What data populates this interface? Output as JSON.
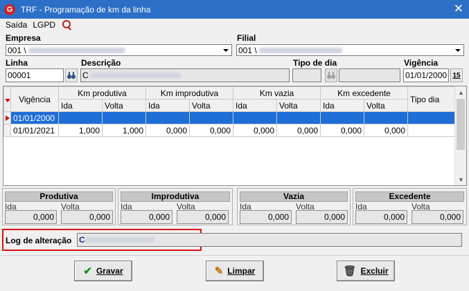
{
  "window": {
    "title": "TRF - Programação de km da linha",
    "close": "✕",
    "app_icon": "G"
  },
  "menu": {
    "items": [
      "Saída",
      "LGPD"
    ],
    "search_icon": "search-icon"
  },
  "empresa": {
    "label": "Empresa",
    "value": "001 \\"
  },
  "filial": {
    "label": "Filial",
    "value": "001 \\"
  },
  "linha": {
    "label": "Linha",
    "value": "00001"
  },
  "descricao": {
    "label": "Descrição",
    "value": "C"
  },
  "tipo_dia": {
    "label": "Tipo de dia",
    "value": ""
  },
  "vigencia": {
    "label": "Vigência",
    "value": "01/01/2000",
    "cal_btn": "15"
  },
  "grid": {
    "headers": {
      "vigencia": "Vigência",
      "km_produtiva": "Km produtiva",
      "km_improdutiva": "Km improdutiva",
      "km_vazia": "Km vazia",
      "km_excedente": "Km excedente",
      "tipo_dia": "Tipo dia"
    },
    "subheaders": [
      "Ida",
      "Volta",
      "Ida",
      "Volta",
      "Ida",
      "Volta",
      "Ida",
      "Volta"
    ],
    "rows": [
      {
        "vigencia": "01/01/2000",
        "cells": [
          "",
          "",
          "",
          "",
          "",
          "",
          "",
          ""
        ],
        "tipo": ""
      },
      {
        "vigencia": "01/01/2021",
        "cells": [
          "1,000",
          "1,000",
          "0,000",
          "0,000",
          "0,000",
          "0,000",
          "0,000",
          "0,000"
        ],
        "tipo": ""
      }
    ]
  },
  "totals": [
    {
      "title": "Produtiva",
      "ida_label": "Ida",
      "volta_label": "Volta",
      "ida": "0,000",
      "volta": "0,000"
    },
    {
      "title": "Improdutiva",
      "ida_label": "Ida",
      "volta_label": "Volta",
      "ida": "0,000",
      "volta": "0,000"
    },
    {
      "title": "Vazia",
      "ida_label": "Ida",
      "volta_label": "Volta",
      "ida": "0,000",
      "volta": "0,000"
    },
    {
      "title": "Excedente",
      "ida_label": "Ida",
      "volta_label": "Volta",
      "ida": "0,000",
      "volta": "0,000"
    }
  ],
  "log": {
    "label": "Log de alteração",
    "value": "C"
  },
  "buttons": {
    "gravar": "Gravar",
    "limpar": "Limpar",
    "excluir": "Excluir"
  }
}
